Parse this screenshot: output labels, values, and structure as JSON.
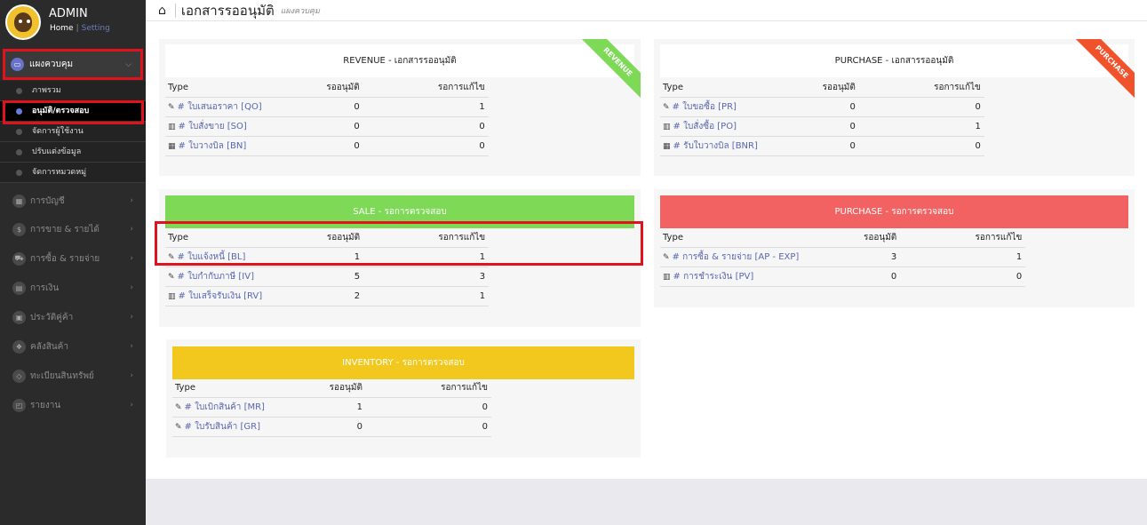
{
  "sidebar": {
    "user": "ADMIN",
    "links": {
      "home": "Home",
      "separator": "|",
      "setting": "Setting"
    },
    "main_item": {
      "label": "แผงควบคุม",
      "icon": "monitor-icon"
    },
    "sub_items": [
      {
        "label": "ภาพรวม"
      },
      {
        "label": "อนุมัติ/ตรวจสอบ"
      },
      {
        "label": "จัดการผู้ใช้งาน"
      },
      {
        "label": "ปรับแต่งข้อมูล"
      },
      {
        "label": "จัดการหมวดหมู่"
      }
    ],
    "nav_items": [
      {
        "label": "การบัญชี",
        "icon": "grid-icon"
      },
      {
        "label": "การขาย & รายได้",
        "icon": "dollar-icon"
      },
      {
        "label": "การซื้อ & รายจ่าย",
        "icon": "cart-icon"
      },
      {
        "label": "การเงิน",
        "icon": "calendar-icon"
      },
      {
        "label": "ประวัติคู่ค้า",
        "icon": "address-book-icon"
      },
      {
        "label": "คลังสินค้า",
        "icon": "cubes-icon"
      },
      {
        "label": "ทะเบียนสินทรัพย์",
        "icon": "diamond-icon"
      },
      {
        "label": "รายงาน",
        "icon": "report-icon"
      }
    ]
  },
  "header": {
    "title": "เอกสารรออนุมัติ",
    "subtitle": "แผงควบคุม"
  },
  "columns": {
    "type": "Type",
    "pending": "รออนุมัติ",
    "fix": "รอการแก้ไข"
  },
  "cards": {
    "revenue": {
      "title": "REVENUE - เอกสารรออนุมัติ",
      "ribbon": "REVENUE",
      "ribbon_color": "#7ed957",
      "rows": [
        {
          "icon": "edit-icon",
          "label": "# ใบเสนอราคา [QO]",
          "pending": "0",
          "fix": "1"
        },
        {
          "icon": "bar-chart-icon",
          "label": "# ใบสั่งขาย [SO]",
          "pending": "0",
          "fix": "0"
        },
        {
          "icon": "calendar-icon",
          "label": "# ใบวางบิล [BN]",
          "pending": "0",
          "fix": "0"
        }
      ]
    },
    "purchase_approve": {
      "title": "PURCHASE - เอกสารรออนุมัติ",
      "ribbon": "PURCHASE",
      "ribbon_color": "#f0522c",
      "rows": [
        {
          "icon": "edit-icon",
          "label": "# ใบขอซื้อ [PR]",
          "pending": "0",
          "fix": "0"
        },
        {
          "icon": "bar-chart-icon",
          "label": "# ใบสั่งซื้อ [PO]",
          "pending": "0",
          "fix": "1"
        },
        {
          "icon": "calendar-icon",
          "label": "# รับใบวางบิล [BNR]",
          "pending": "0",
          "fix": "0"
        }
      ]
    },
    "sale": {
      "title": "SALE - รอการตรวจสอบ",
      "color": "#7ed957",
      "rows": [
        {
          "icon": "edit-icon",
          "label": "# ใบแจ้งหนี้ [BL]",
          "pending": "1",
          "fix": "1"
        },
        {
          "icon": "edit-icon",
          "label": "# ใบกำกับภาษี [IV]",
          "pending": "5",
          "fix": "3"
        },
        {
          "icon": "bar-chart-icon",
          "label": "# ใบเสร็จรับเงิน [RV]",
          "pending": "2",
          "fix": "1"
        }
      ]
    },
    "purchase_check": {
      "title": "PURCHASE - รอการตรวจสอบ",
      "color": "#f26262",
      "rows": [
        {
          "icon": "edit-icon",
          "label": "# การซื้อ & รายจ่าย [AP - EXP]",
          "pending": "3",
          "fix": "1"
        },
        {
          "icon": "bar-chart-icon",
          "label": "# การชำระเงิน [PV]",
          "pending": "0",
          "fix": "0"
        }
      ]
    },
    "inventory": {
      "title": "INVENTORY - รอการตรวจสอบ",
      "color": "#f2c81e",
      "rows": [
        {
          "icon": "edit-icon",
          "label": "# ใบเบิกสินค้า [MR]",
          "pending": "1",
          "fix": "0"
        },
        {
          "icon": "edit-icon",
          "label": "# ใบรับสินค้า [GR]",
          "pending": "0",
          "fix": "0"
        }
      ]
    }
  }
}
